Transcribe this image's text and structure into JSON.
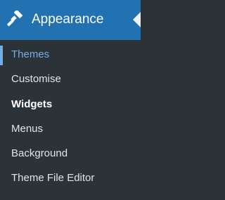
{
  "menu": {
    "title": "Appearance",
    "icon": "paintbrush-icon",
    "colors": {
      "header_bg": "#2271b1",
      "submenu_bg": "#2c3338",
      "current_text": "#72aee6",
      "text": "#e2e4e6",
      "arrow": "#f0f0f1"
    },
    "items": [
      {
        "label": "Themes",
        "state": "current"
      },
      {
        "label": "Customise",
        "state": "normal"
      },
      {
        "label": "Widgets",
        "state": "bold"
      },
      {
        "label": "Menus",
        "state": "normal"
      },
      {
        "label": "Background",
        "state": "normal"
      },
      {
        "label": "Theme File Editor",
        "state": "normal"
      }
    ]
  }
}
